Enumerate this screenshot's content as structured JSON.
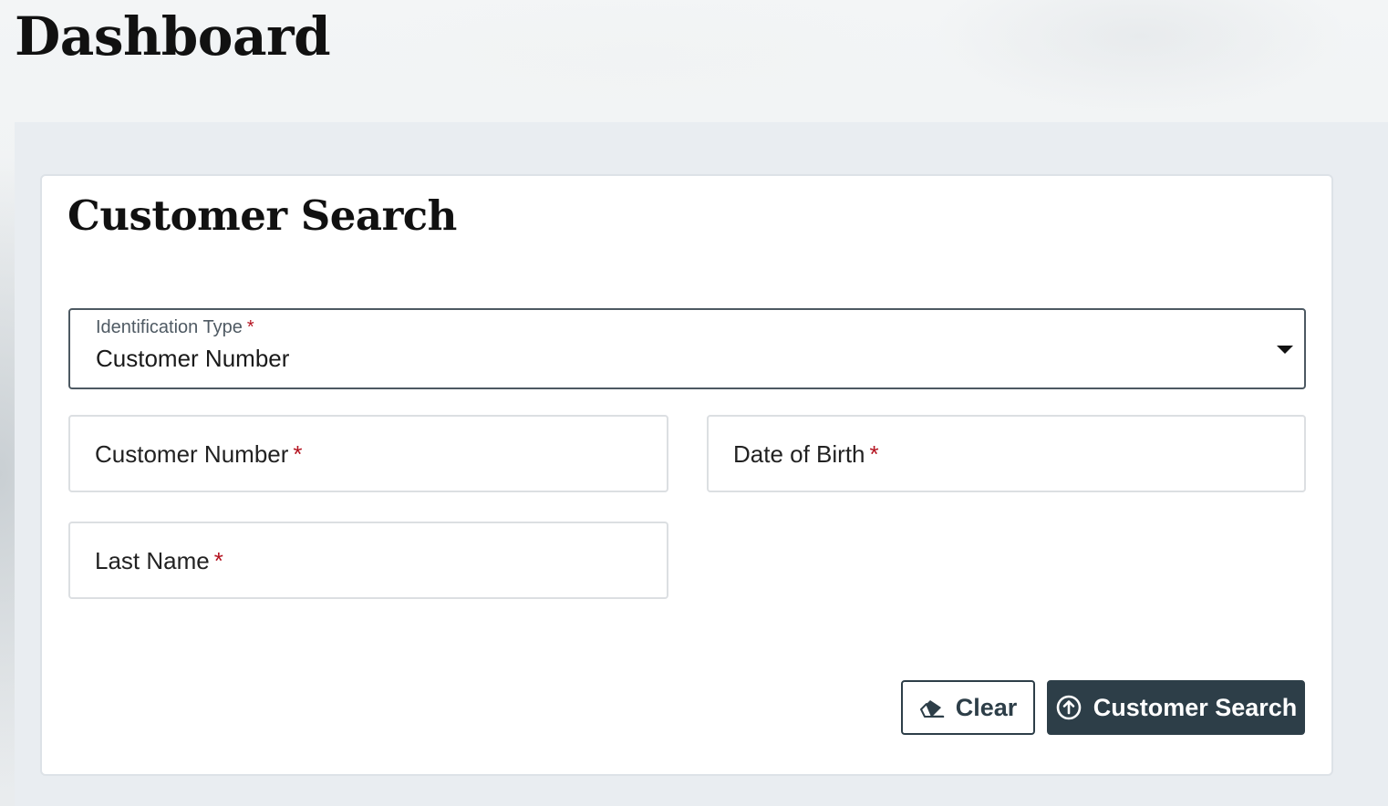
{
  "header": {
    "title": "Dashboard"
  },
  "card": {
    "title": "Customer Search"
  },
  "identification_type": {
    "label": "Identification Type",
    "required_mark": "*",
    "selected_value": "Customer Number",
    "icon": "caret-down-icon"
  },
  "fields": {
    "customer_number": {
      "label": "Customer Number",
      "required_mark": "*"
    },
    "date_of_birth": {
      "label": "Date of Birth",
      "required_mark": "*"
    },
    "last_name": {
      "label": "Last Name",
      "required_mark": "*"
    }
  },
  "buttons": {
    "clear": {
      "label": "Clear",
      "icon": "eraser-icon"
    },
    "search": {
      "label": "Customer Search",
      "icon": "circle-arrow-up-icon"
    }
  },
  "colors": {
    "primary": "#2d3e48",
    "required": "#b4121f",
    "panel_background": "#e9edf1"
  }
}
